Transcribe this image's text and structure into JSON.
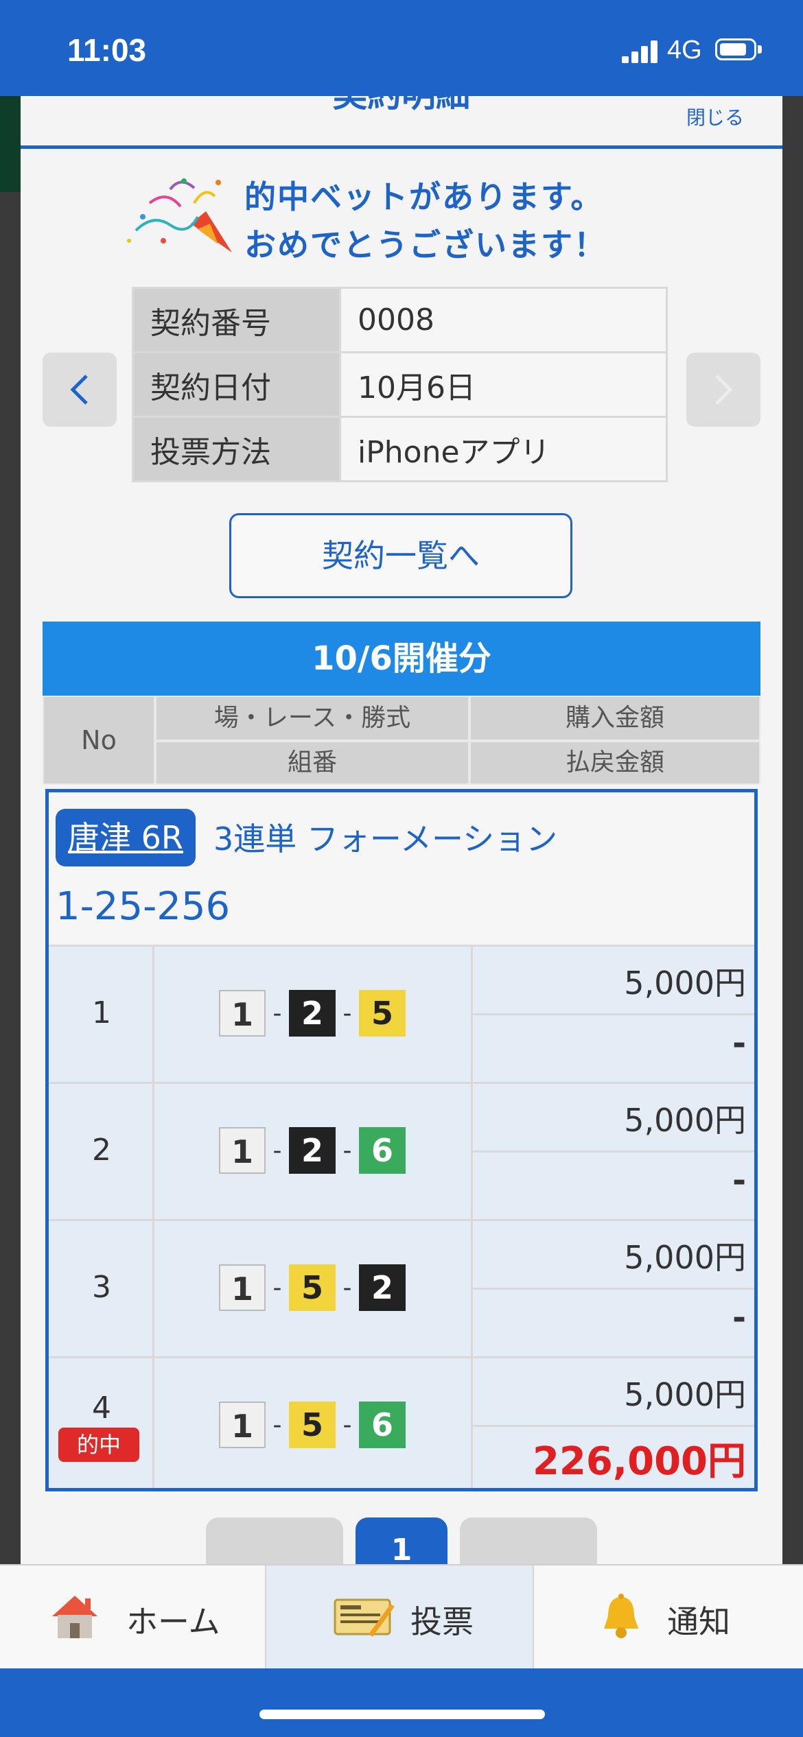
{
  "status_bar": {
    "time": "11:03",
    "network": "4G"
  },
  "modal": {
    "title": "契約明細",
    "close": "閉じる",
    "congrats_line1": "的中ベットがあります。",
    "congrats_line2": "おめでとうございます！",
    "info": [
      {
        "key": "契約番号",
        "value": "0008"
      },
      {
        "key": "契約日付",
        "value": "10月6日"
      },
      {
        "key": "投票方法",
        "value": "iPhoneアプリ"
      }
    ],
    "list_button": "契約一覧へ",
    "date_header": "10/6開催分",
    "table_headers": {
      "no": "No",
      "race": "場・レース・勝式",
      "purchase": "購入金額",
      "combination": "組番",
      "payout": "払戻金額"
    },
    "race_badge": "唐津 6R",
    "bet_type": "3連単 フォーメーション",
    "combo_text": "1-25-256",
    "rows": [
      {
        "no": "1",
        "combo": [
          "1",
          "2",
          "5"
        ],
        "dash": "-",
        "amount": "5,000円",
        "payout": "-",
        "hit": ""
      },
      {
        "no": "2",
        "combo": [
          "1",
          "2",
          "6"
        ],
        "dash": "-",
        "amount": "5,000円",
        "payout": "-",
        "hit": ""
      },
      {
        "no": "3",
        "combo": [
          "1",
          "5",
          "2"
        ],
        "dash": "-",
        "amount": "5,000円",
        "payout": "-",
        "hit": ""
      },
      {
        "no": "4",
        "combo": [
          "1",
          "5",
          "6"
        ],
        "dash": "-",
        "amount": "5,000円",
        "payout": "226,000円",
        "hit": "的中"
      }
    ],
    "pager": {
      "current": "1"
    }
  },
  "tabs": [
    {
      "label": "ホーム",
      "icon": "house-icon"
    },
    {
      "label": "投票",
      "icon": "ticket-icon"
    },
    {
      "label": "通知",
      "icon": "bell-icon"
    }
  ],
  "colors": {
    "brand": "#1e64c8",
    "header_blue": "#1e8ae6",
    "win_red": "#e02020"
  }
}
